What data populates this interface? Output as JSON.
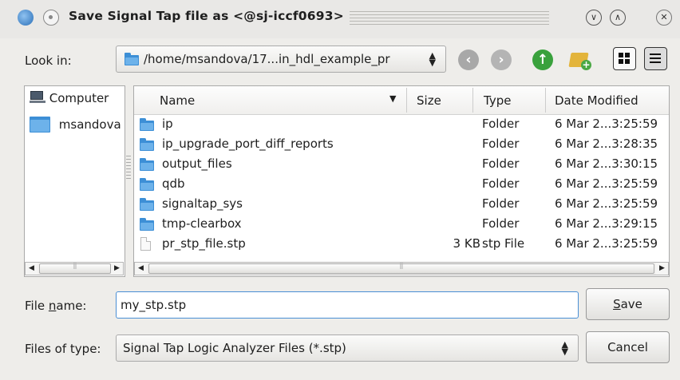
{
  "window": {
    "title": "Save Signal Tap file as <@sj-iccf0693>",
    "minimize_glyph": "∨",
    "maximize_glyph": "∧",
    "close_glyph": "✕"
  },
  "toolbar": {
    "look_in_label": "Look in:",
    "path": "/home/msandova/17...in_hdl_example_pr",
    "icons": [
      "back-icon",
      "forward-icon",
      "up-folder-icon",
      "new-folder-icon",
      "list-view-icon",
      "detail-view-icon"
    ]
  },
  "sidebar": {
    "items": [
      {
        "label": "Computer",
        "icon": "computer-icon"
      },
      {
        "label": "msandova",
        "icon": "folder-icon"
      }
    ]
  },
  "file_list": {
    "columns": [
      "Name",
      "Size",
      "Type",
      "Date Modified"
    ],
    "rows": [
      {
        "name": "ip",
        "size": "",
        "type": "Folder",
        "date": "6 Mar 2...3:25:59",
        "icon": "folder-icon"
      },
      {
        "name": "ip_upgrade_port_diff_reports",
        "size": "",
        "type": "Folder",
        "date": "6 Mar 2...3:28:35",
        "icon": "folder-icon"
      },
      {
        "name": "output_files",
        "size": "",
        "type": "Folder",
        "date": "6 Mar 2...3:30:15",
        "icon": "folder-icon"
      },
      {
        "name": "qdb",
        "size": "",
        "type": "Folder",
        "date": "6 Mar 2...3:25:59",
        "icon": "folder-icon"
      },
      {
        "name": "signaltap_sys",
        "size": "",
        "type": "Folder",
        "date": "6 Mar 2...3:25:59",
        "icon": "folder-icon"
      },
      {
        "name": "tmp-clearbox",
        "size": "",
        "type": "Folder",
        "date": "6 Mar 2...3:29:15",
        "icon": "folder-icon"
      },
      {
        "name": "pr_stp_file.stp",
        "size": "3 KB",
        "type": "stp File",
        "date": "6 Mar 2...3:25:59",
        "icon": "file-icon"
      }
    ]
  },
  "form": {
    "file_name_label_pre": "File ",
    "file_name_label_u": "n",
    "file_name_label_post": "ame:",
    "file_name_value": "my_stp.stp",
    "file_type_label": "Files of type:",
    "file_type_value": "Signal Tap Logic Analyzer Files (*.stp)",
    "save_u": "S",
    "save_rest": "ave",
    "cancel_label": "Cancel"
  },
  "colors": {
    "accent": "#4a8fd5",
    "folder": "#3d8fd6",
    "up_arrow": "#39a13c"
  }
}
